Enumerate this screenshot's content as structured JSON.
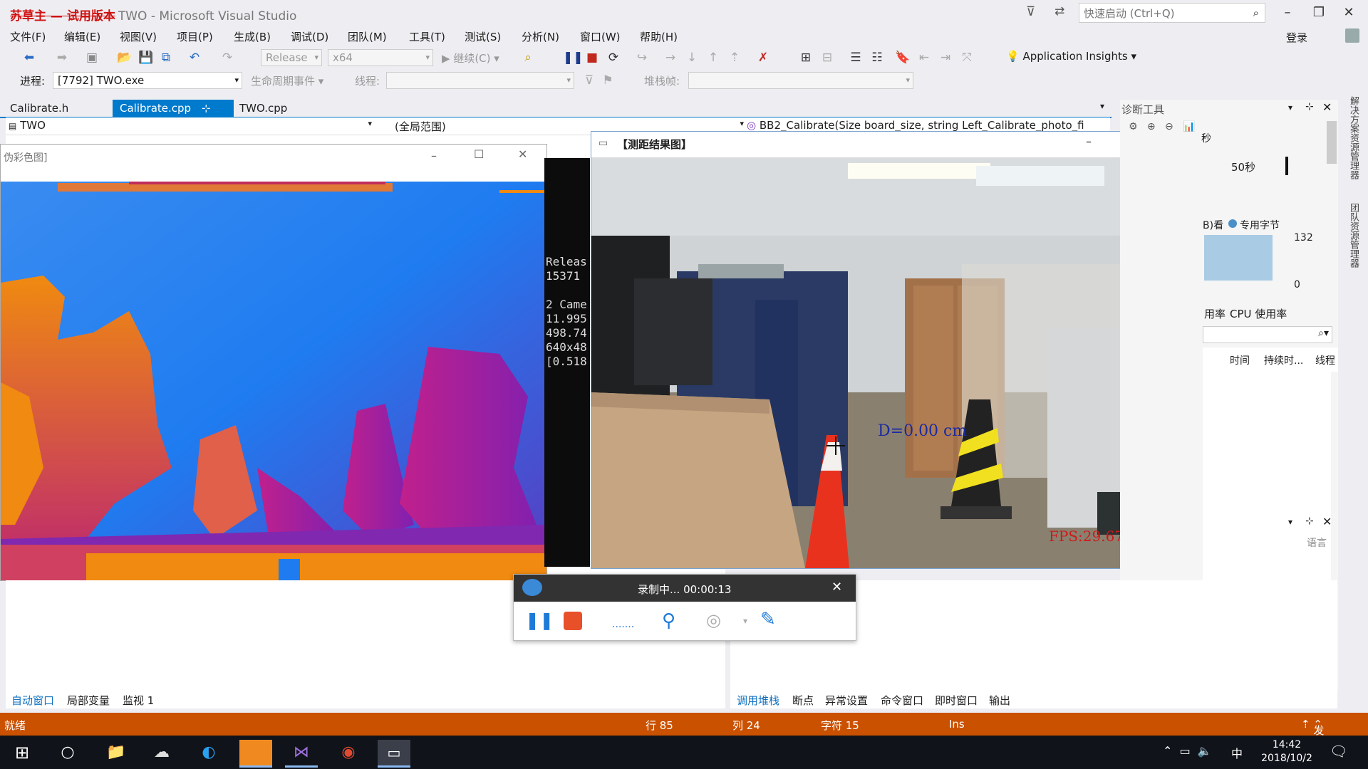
{
  "titlebar": {
    "badge": "苏草主 — 试用版本",
    "title": "TWO - Microsoft Visual Studio",
    "quick_launch_placeholder": "快速启动 (Ctrl+Q)",
    "login": "登录"
  },
  "menu": [
    "文件(F)",
    "编辑(E)",
    "视图(V)",
    "项目(P)",
    "生成(B)",
    "调试(D)",
    "团队(M)",
    "工具(T)",
    "测试(S)",
    "分析(N)",
    "窗口(W)",
    "帮助(H)"
  ],
  "toolbar": {
    "config": "Release",
    "platform": "x64",
    "continue": "继续(C)",
    "app_insights": "Application Insights"
  },
  "procbar": {
    "process_label": "进程:",
    "process_value": "[7792] TWO.exe",
    "lifecycle": "生命周期事件",
    "thread_label": "线程:",
    "stack_label": "堆栈帧:"
  },
  "tabs": [
    {
      "label": "Calibrate.h",
      "active": false
    },
    {
      "label": "Calibrate.cpp",
      "active": true
    },
    {
      "label": "TWO.cpp",
      "active": false
    }
  ],
  "nav": {
    "project": "TWO",
    "scope": "(全局范围)",
    "function": "BB2_Calibrate(Size board_size, string Left_Calibrate_photo_fi"
  },
  "depth_window": {
    "title": "伪彩色图]"
  },
  "console": {
    "lines": [
      "Releas",
      " 15371",
      "",
      "2 Came",
      "11.995",
      "498.74",
      "640x48",
      "[0.518"
    ]
  },
  "result_window": {
    "title": "【测距结果图】",
    "distance_text": "D=0.00 cm",
    "fps_text": "FPS:29.67"
  },
  "diag": {
    "title": "诊断工具",
    "time_label": "50秒",
    "bytes_label": "B)看",
    "private_bytes": "专用字节",
    "max_value": "132",
    "min_value": "0",
    "cpu_tab1": "用率",
    "cpu_tab2": "CPU 使用率",
    "col_time": "时间",
    "col_duration": "持续时...",
    "col_thread": "线程",
    "second": "秒",
    "bottom_lang": "语言"
  },
  "bottom_tabs_left": [
    "自动窗口",
    "局部变量",
    "监视 1"
  ],
  "bottom_tabs_right": [
    "调用堆栈",
    "断点",
    "异常设置",
    "命令窗口",
    "即时窗口",
    "输出"
  ],
  "recording": {
    "status": "录制中... 00:00:13"
  },
  "statusbar": {
    "ready": "就绪",
    "row": "行 85",
    "col": "列 24",
    "char": "字符 15",
    "ins": "Ins",
    "publish": "发布"
  },
  "taskbar": {
    "time": "14:42",
    "date": "2018/10/2",
    "ime": "中"
  },
  "vert_strip": [
    "解决方案资源管理器",
    "团队资源管理器"
  ],
  "colors": {
    "vs_blue": "#007acc",
    "status_orange": "#ca5100",
    "depth_blue": "#1f7cf0",
    "depth_orange": "#f08a10"
  }
}
